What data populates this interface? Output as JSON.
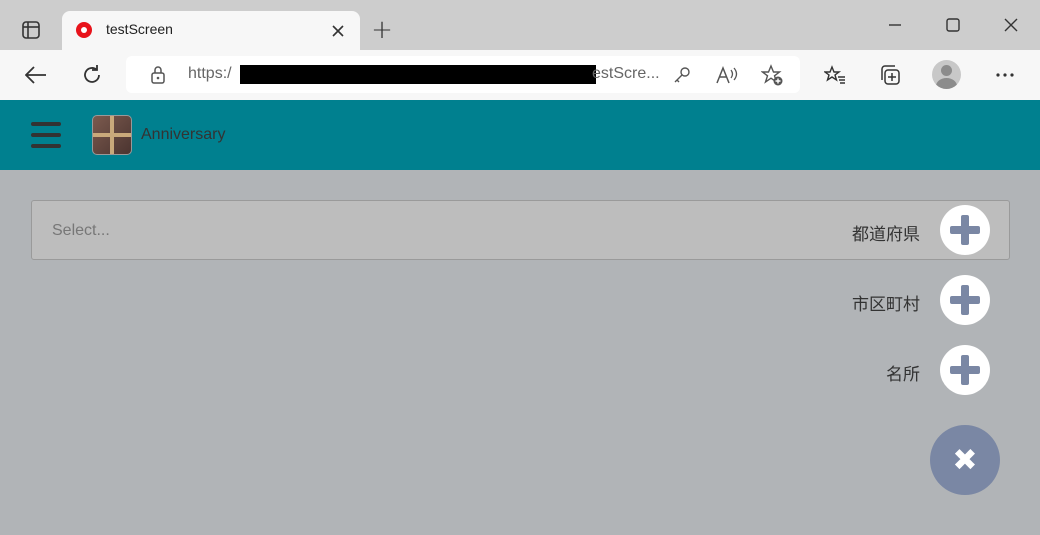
{
  "browser": {
    "tab_title": "testScreen",
    "new_tab_symbol": "+",
    "url_prefix": "https:/",
    "url_suffix": "estScre...",
    "window_controls": [
      "minimize-icon",
      "maximize-icon",
      "close-icon"
    ],
    "toolbar_icons": [
      "back-icon",
      "refresh-icon",
      "lock-icon",
      "key-icon",
      "read-aloud-icon",
      "add-favorite-icon",
      "favorites-icon",
      "collections-icon",
      "profile-icon",
      "more-icon"
    ]
  },
  "app": {
    "title": "Anniversary",
    "select_placeholder": "Select...",
    "fab_actions": [
      {
        "label": "都道府県"
      },
      {
        "label": "市区町村"
      },
      {
        "label": "名所"
      }
    ],
    "fab_main_symbol": "✖",
    "colors": {
      "appbar": "#00808f",
      "fab": "#7a87a4",
      "overlay": "#b1b4b7"
    }
  }
}
